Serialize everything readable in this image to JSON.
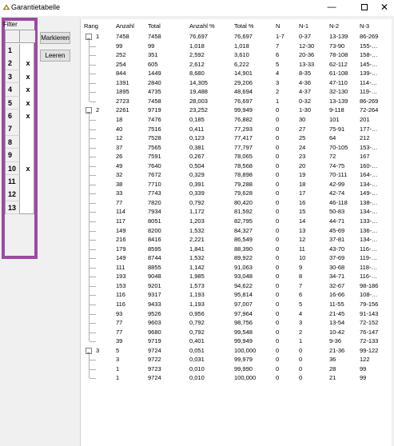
{
  "window": {
    "title": "Garantietabelle",
    "minimize": "—",
    "close": "✕"
  },
  "filter": {
    "label": "Filter",
    "rows": [
      {
        "num": "1",
        "mark": ""
      },
      {
        "num": "2",
        "mark": "x"
      },
      {
        "num": "3",
        "mark": "x"
      },
      {
        "num": "4",
        "mark": "x"
      },
      {
        "num": "5",
        "mark": "x"
      },
      {
        "num": "6",
        "mark": "x"
      },
      {
        "num": "7",
        "mark": ""
      },
      {
        "num": "8",
        "mark": ""
      },
      {
        "num": "9",
        "mark": ""
      },
      {
        "num": "10",
        "mark": "x"
      },
      {
        "num": "11",
        "mark": ""
      },
      {
        "num": "12",
        "mark": ""
      },
      {
        "num": "13",
        "mark": ""
      }
    ],
    "highlight_color": "#9b4aa2"
  },
  "buttons": {
    "markieren": "Markieren",
    "leeren": "Leeren"
  },
  "table": {
    "columns": [
      "Rang",
      "Anzahl",
      "Total",
      "Anzahl %",
      "Total %",
      "N",
      "N-1",
      "N-2",
      "N-3"
    ],
    "rows": [
      {
        "group": "1",
        "expander": "−",
        "cells": [
          "7458",
          "7458",
          "76,697",
          "76,697",
          "1-7",
          "0-37",
          "13-139",
          "86-269"
        ]
      },
      {
        "cells": [
          "99",
          "99",
          "1,018",
          "1,018",
          "7",
          "12-30",
          "73-90",
          "155-…"
        ]
      },
      {
        "cells": [
          "252",
          "351",
          "2,592",
          "3,610",
          "6",
          "20-36",
          "78-108",
          "158-…"
        ]
      },
      {
        "cells": [
          "254",
          "605",
          "2,612",
          "6,222",
          "5",
          "13-33",
          "62-112",
          "145-…"
        ]
      },
      {
        "cells": [
          "844",
          "1449",
          "8,680",
          "14,901",
          "4",
          "8-35",
          "61-108",
          "139-…"
        ]
      },
      {
        "cells": [
          "1391",
          "2840",
          "14,305",
          "29,206",
          "3",
          "4-36",
          "47-110",
          "114-…"
        ]
      },
      {
        "cells": [
          "1895",
          "4735",
          "19,488",
          "48,694",
          "2",
          "4-37",
          "32-130",
          "119-…"
        ]
      },
      {
        "cells": [
          "2723",
          "7458",
          "28,003",
          "76,697",
          "1",
          "0-32",
          "13-139",
          "86-269"
        ]
      },
      {
        "group": "2",
        "expander": "−",
        "cells": [
          "2261",
          "9719",
          "23,252",
          "99,949",
          "0",
          "1-30",
          "9-118",
          "72-264"
        ]
      },
      {
        "cells": [
          "18",
          "7476",
          "0,185",
          "76,882",
          "0",
          "30",
          "101",
          "201"
        ]
      },
      {
        "cells": [
          "40",
          "7516",
          "0,411",
          "77,293",
          "0",
          "27",
          "75-91",
          "177-…"
        ]
      },
      {
        "cells": [
          "12",
          "7528",
          "0,123",
          "77,417",
          "0",
          "25",
          "64",
          "212"
        ]
      },
      {
        "cells": [
          "37",
          "7565",
          "0,381",
          "77,797",
          "0",
          "24",
          "70-105",
          "153-…"
        ]
      },
      {
        "cells": [
          "26",
          "7591",
          "0,267",
          "78,065",
          "0",
          "23",
          "72",
          "167"
        ]
      },
      {
        "cells": [
          "49",
          "7640",
          "0,504",
          "78,568",
          "0",
          "20",
          "74-75",
          "160-…"
        ]
      },
      {
        "cells": [
          "32",
          "7672",
          "0,329",
          "78,898",
          "0",
          "19",
          "70-111",
          "164-…"
        ]
      },
      {
        "cells": [
          "38",
          "7710",
          "0,391",
          "79,288",
          "0",
          "18",
          "42-99",
          "134-…"
        ]
      },
      {
        "cells": [
          "33",
          "7743",
          "0,339",
          "79,628",
          "0",
          "17",
          "42-74",
          "149-…"
        ]
      },
      {
        "cells": [
          "77",
          "7820",
          "0,792",
          "80,420",
          "0",
          "16",
          "46-118",
          "138-…"
        ]
      },
      {
        "cells": [
          "114",
          "7934",
          "1,172",
          "81,592",
          "0",
          "15",
          "50-83",
          "134-…"
        ]
      },
      {
        "cells": [
          "117",
          "8051",
          "1,203",
          "82,795",
          "0",
          "14",
          "44-71",
          "133-…"
        ]
      },
      {
        "cells": [
          "149",
          "8200",
          "1,532",
          "84,327",
          "0",
          "13",
          "45-69",
          "136-…"
        ]
      },
      {
        "cells": [
          "216",
          "8416",
          "2,221",
          "86,549",
          "0",
          "12",
          "37-81",
          "134-…"
        ]
      },
      {
        "cells": [
          "179",
          "8595",
          "1,841",
          "88,390",
          "0",
          "11",
          "43-70",
          "116-…"
        ]
      },
      {
        "cells": [
          "149",
          "8744",
          "1,532",
          "89,922",
          "0",
          "10",
          "37-69",
          "119-…"
        ]
      },
      {
        "cells": [
          "111",
          "8855",
          "1,142",
          "91,063",
          "0",
          "9",
          "30-68",
          "118-…"
        ]
      },
      {
        "cells": [
          "193",
          "9048",
          "1,985",
          "93,048",
          "0",
          "8",
          "34-71",
          "116-…"
        ]
      },
      {
        "cells": [
          "153",
          "9201",
          "1,573",
          "94,622",
          "0",
          "7",
          "32-67",
          "98-186"
        ]
      },
      {
        "cells": [
          "116",
          "9317",
          "1,193",
          "95,814",
          "0",
          "6",
          "16-66",
          "108-…"
        ]
      },
      {
        "cells": [
          "116",
          "9433",
          "1,193",
          "97,007",
          "0",
          "5",
          "11-55",
          "79-156"
        ]
      },
      {
        "cells": [
          "93",
          "9526",
          "0,956",
          "97,964",
          "0",
          "4",
          "21-45",
          "91-143"
        ]
      },
      {
        "cells": [
          "77",
          "9603",
          "0,792",
          "98,756",
          "0",
          "3",
          "13-54",
          "72-152"
        ]
      },
      {
        "cells": [
          "77",
          "9680",
          "0,792",
          "99,548",
          "0",
          "2",
          "10-42",
          "76-147"
        ]
      },
      {
        "cells": [
          "39",
          "9719",
          "0,401",
          "99,949",
          "0",
          "1",
          "9-36",
          "72-133"
        ]
      },
      {
        "group": "3",
        "expander": "−",
        "cells": [
          "5",
          "9724",
          "0,051",
          "100,000",
          "0",
          "0",
          "21-36",
          "99-122"
        ]
      },
      {
        "cells": [
          "3",
          "9722",
          "0,031",
          "99,979",
          "0",
          "0",
          "36",
          "122"
        ]
      },
      {
        "cells": [
          "1",
          "9723",
          "0,010",
          "99,990",
          "0",
          "0",
          "28",
          "99"
        ]
      },
      {
        "cells": [
          "1",
          "9724",
          "0,010",
          "100,000",
          "0",
          "0",
          "21",
          "99"
        ]
      }
    ]
  }
}
